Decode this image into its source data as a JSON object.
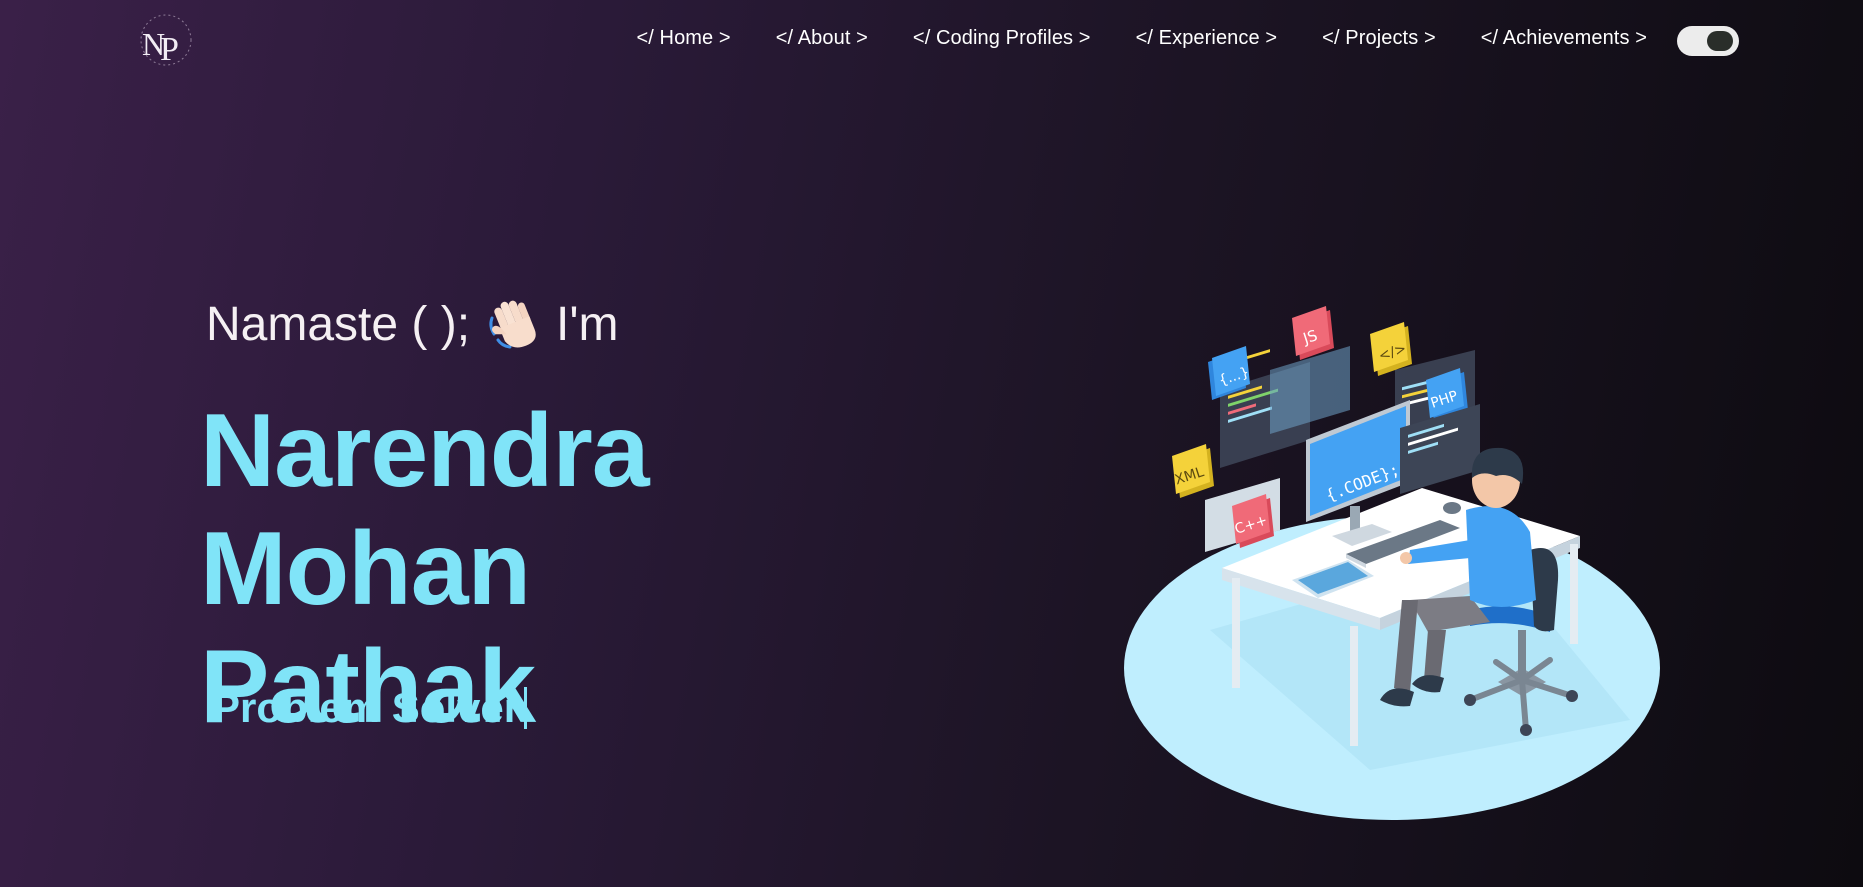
{
  "brand": {
    "logo_letters": "NP",
    "logo_icon": "np-monogram-logo"
  },
  "nav": {
    "items": [
      {
        "label": "</ Home >"
      },
      {
        "label": "</ About >"
      },
      {
        "label": "</ Coding Profiles >"
      },
      {
        "label": "</ Experience >"
      },
      {
        "label": "</ Projects >"
      },
      {
        "label": "</ Achievements >"
      }
    ],
    "theme_toggle_icon": "dark-mode-toggle"
  },
  "hero": {
    "greeting_prefix": "Namaste ( );",
    "greeting_icon": "waving-hand-icon",
    "greeting_suffix": "I'm",
    "name_line1": "Narendra Mohan",
    "name_line2": "Pathak",
    "role": "Problem Solver",
    "illustration": "developer-at-desk-illustration"
  },
  "illustration_labels": {
    "badge_braces": "{...}",
    "badge_js": "JS",
    "badge_tag": "</>",
    "badge_php": "PHP",
    "badge_xml": "XML",
    "badge_cpp": "C++",
    "monitor_text": "{.CODE};"
  },
  "colors": {
    "accent": "#80e4f8",
    "background_start": "#3a2048",
    "background_end": "#0d0b10",
    "text": "#ffffff"
  }
}
